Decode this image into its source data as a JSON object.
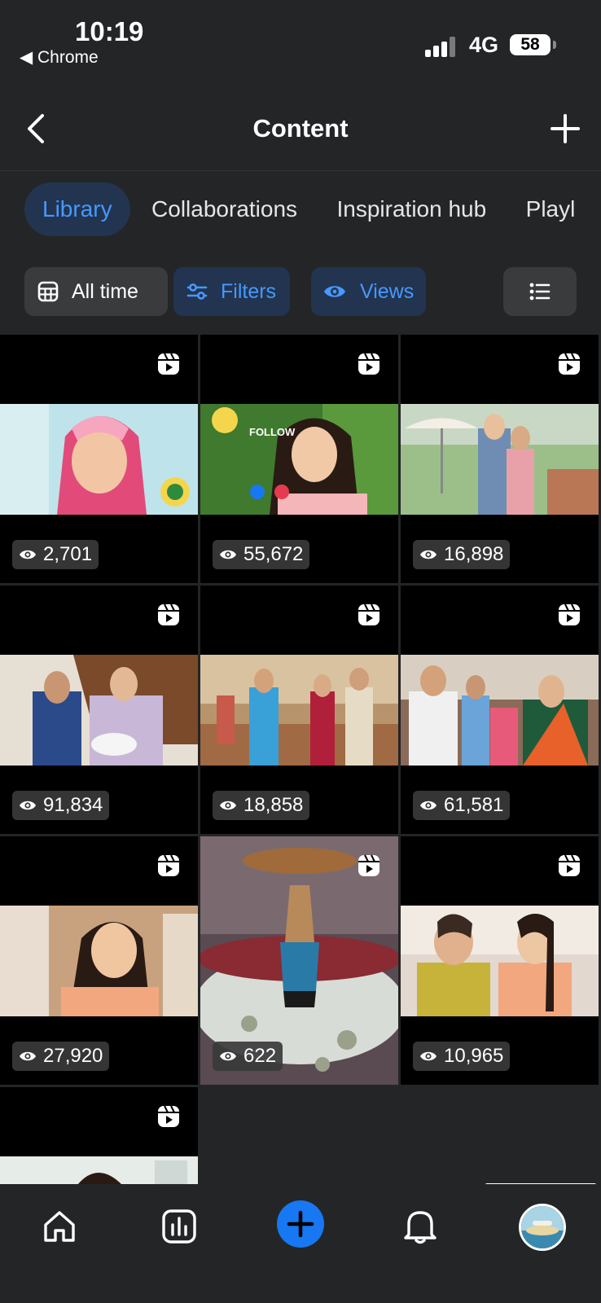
{
  "status_bar": {
    "time": "10:19",
    "back_app": "◀ Chrome",
    "network": "4G",
    "battery": "58"
  },
  "header": {
    "title": "Content",
    "back_icon": "chevron-left-icon",
    "add_icon": "plus-icon"
  },
  "tabs": [
    {
      "label": "Library",
      "active": true
    },
    {
      "label": "Collaborations",
      "active": false
    },
    {
      "label": "Inspiration hub",
      "active": false
    },
    {
      "label": "Playl",
      "active": false
    }
  ],
  "filters": {
    "time_label": "All time",
    "filters_label": "Filters",
    "views_label": "Views",
    "list_icon": "list-view-icon"
  },
  "grid": {
    "items": [
      {
        "views": "2,701"
      },
      {
        "views": "55,672"
      },
      {
        "views": "16,898"
      },
      {
        "views": "91,834"
      },
      {
        "views": "18,858"
      },
      {
        "views": "61,581"
      },
      {
        "views": "27,920"
      },
      {
        "views": "622"
      },
      {
        "views": "10,965"
      },
      {
        "views": ""
      }
    ]
  },
  "thumb_overlays": {
    "item2_follow": "FOLLOW"
  },
  "bottom_nav": {
    "items": [
      "home-icon",
      "insights-icon",
      "create-icon",
      "notifications-icon",
      "profile-avatar"
    ]
  },
  "colors": {
    "background": "#242526",
    "accent_blue": "#4599ff",
    "chip_blue_bg": "#233450",
    "chip_gray_bg": "#3a3b3c",
    "create_button": "#1877f2"
  }
}
